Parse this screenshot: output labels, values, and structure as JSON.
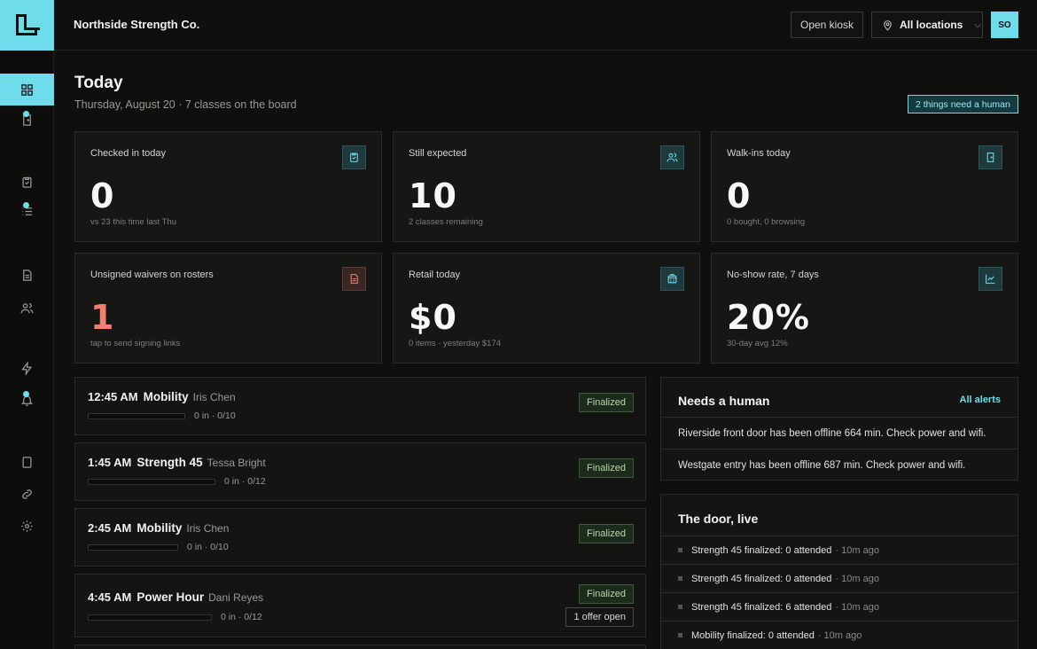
{
  "header": {
    "org_name": "Northside Strength Co.",
    "kiosk_label": "Open kiosk",
    "location_label": "All locations",
    "avatar_initials": "SO"
  },
  "page": {
    "title": "Today",
    "subtitle": "Thursday, August 20 · 7 classes on the board",
    "alert_badge": "2 things need a human"
  },
  "stats": [
    {
      "title": "Checked in today",
      "value": "0",
      "foot": "vs 23 this time last Thu",
      "icon": "clipboard-check-icon"
    },
    {
      "title": "Still expected",
      "value": "10",
      "foot": "2 classes remaining",
      "icon": "users-icon"
    },
    {
      "title": "Walk-ins today",
      "value": "0",
      "foot": "0 bought, 0 browsing",
      "icon": "door-icon"
    },
    {
      "title": "Unsigned waivers on rosters",
      "value": "1",
      "foot": "tap to send signing links",
      "icon": "document-icon",
      "accent": "#f08070"
    },
    {
      "title": "Retail today",
      "value": "$0",
      "foot": "0 items · yesterday $174",
      "icon": "register-icon"
    },
    {
      "title": "No-show rate, 7 days",
      "value": "20%",
      "foot": "30-day avg 12%",
      "icon": "trend-chart-icon"
    }
  ],
  "classes": [
    {
      "time": "12:45 AM",
      "name": "Mobility",
      "coach": "Iris Chen",
      "count_text": "0 in · 0/10",
      "checked_in": 0,
      "capacity": 10,
      "status": "Finalized"
    },
    {
      "time": "1:45 AM",
      "name": "Strength 45",
      "coach": "Tessa Bright",
      "count_text": "0 in · 0/12",
      "checked_in": 0,
      "capacity": 12,
      "status": "Finalized"
    },
    {
      "time": "2:45 AM",
      "name": "Mobility",
      "coach": "Iris Chen",
      "count_text": "0 in · 0/10",
      "checked_in": 0,
      "capacity": 10,
      "status": "Finalized"
    },
    {
      "time": "4:45 AM",
      "name": "Power Hour",
      "coach": "Dani Reyes",
      "count_text": "0 in · 0/12",
      "checked_in": 0,
      "capacity": 12,
      "status": "Finalized",
      "offer": "1 offer open"
    }
  ],
  "needs_human": {
    "title": "Needs a human",
    "link": "All alerts",
    "items": [
      "Riverside front door has been offline 664 min. Check power and wifi.",
      "Westgate entry has been offline 687 min. Check power and wifi."
    ]
  },
  "door_feed": {
    "title": "The door, live",
    "items": [
      {
        "text": "Strength 45 finalized: 0 attended",
        "ago": "· 10m ago"
      },
      {
        "text": "Strength 45 finalized: 0 attended",
        "ago": "· 10m ago"
      },
      {
        "text": "Strength 45 finalized: 6 attended",
        "ago": "· 10m ago"
      },
      {
        "text": "Mobility finalized: 0 attended",
        "ago": "· 10m ago"
      }
    ]
  },
  "colors": {
    "accent": "#6fdcec",
    "warn": "#f08070",
    "finalized": "#b6d7a8"
  }
}
